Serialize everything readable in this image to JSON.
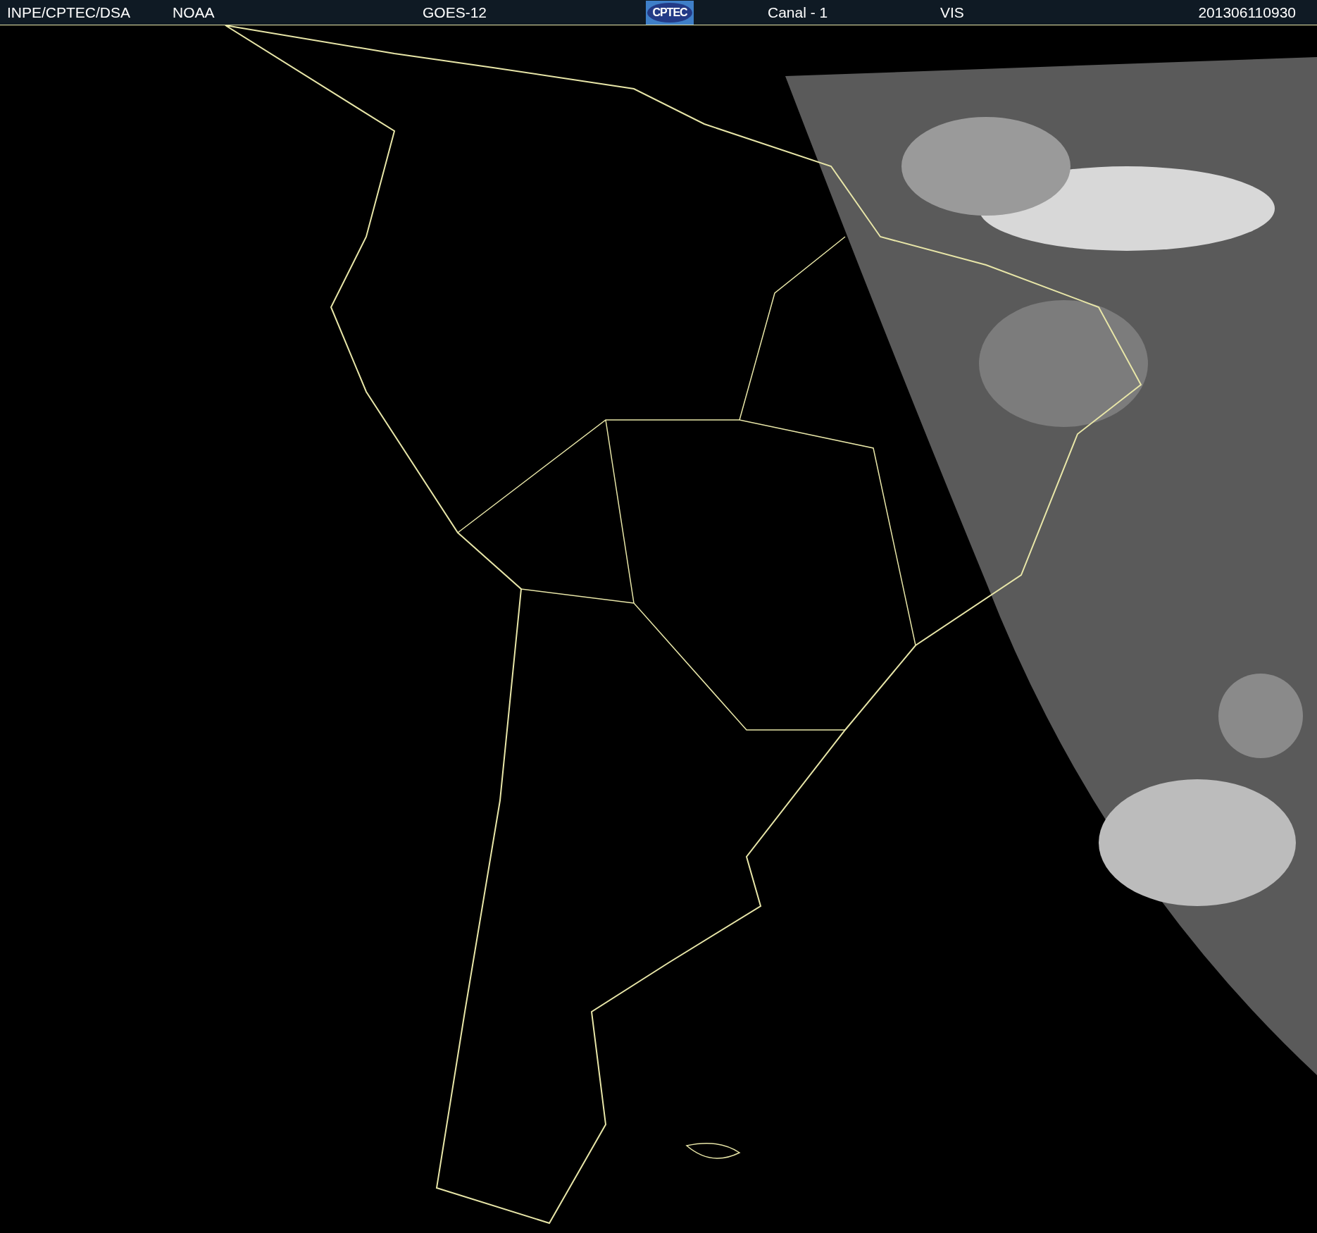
{
  "header": {
    "source": "INPE/CPTEC/DSA",
    "agency": "NOAA",
    "satellite": "GOES-12",
    "logo_text": "CPTEC",
    "channel": "Canal - 1",
    "band": "VIS",
    "timestamp": "201306110930"
  }
}
